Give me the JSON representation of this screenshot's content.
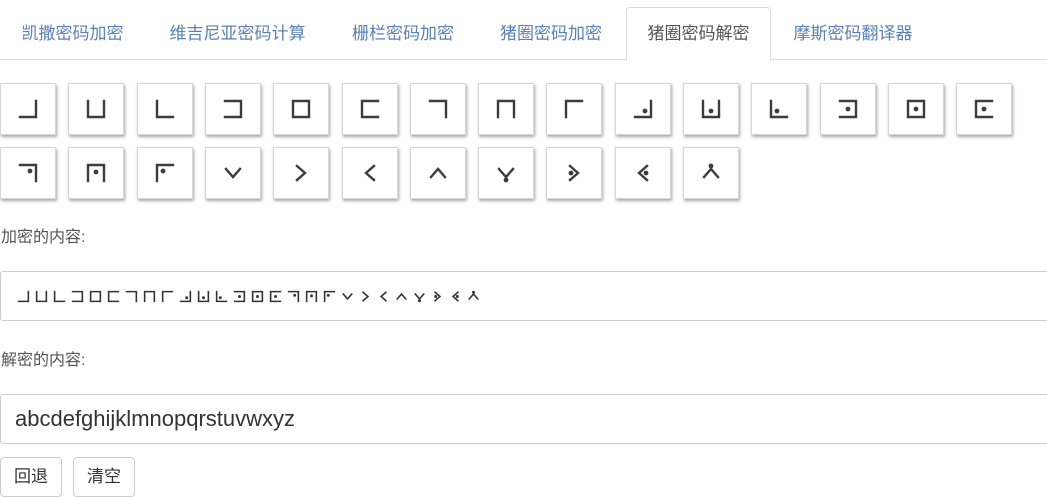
{
  "tabs": [
    {
      "label": "凯撒密码加密"
    },
    {
      "label": "维吉尼亚密码计算"
    },
    {
      "label": "栅栏密码加密"
    },
    {
      "label": "猪圈密码加密"
    },
    {
      "label": "猪圈密码解密",
      "active": true
    },
    {
      "label": "摩斯密码翻译器"
    }
  ],
  "keys_row1": [
    {
      "glyph": "grid-br"
    },
    {
      "glyph": "grid-b"
    },
    {
      "glyph": "grid-bl"
    },
    {
      "glyph": "grid-r"
    },
    {
      "glyph": "grid-c"
    },
    {
      "glyph": "grid-l"
    },
    {
      "glyph": "grid-tr"
    },
    {
      "glyph": "grid-t"
    },
    {
      "glyph": "grid-tl"
    },
    {
      "glyph": "grid-br-dot"
    },
    {
      "glyph": "grid-b-dot"
    },
    {
      "glyph": "grid-bl-dot"
    },
    {
      "glyph": "grid-r-dot"
    },
    {
      "glyph": "grid-c-dot"
    },
    {
      "glyph": "grid-l-dot"
    }
  ],
  "keys_row2": [
    {
      "glyph": "grid-tr-dot"
    },
    {
      "glyph": "grid-t-dot"
    },
    {
      "glyph": "grid-tl-dot"
    },
    {
      "glyph": "x-b"
    },
    {
      "glyph": "x-l"
    },
    {
      "glyph": "x-r"
    },
    {
      "glyph": "x-t"
    },
    {
      "glyph": "x-b-dot"
    },
    {
      "glyph": "x-l-dot"
    },
    {
      "glyph": "x-r-dot"
    },
    {
      "glyph": "x-t-dot"
    }
  ],
  "encrypted": {
    "label": "加密的内容:",
    "glyphs": [
      "grid-br",
      "grid-b",
      "grid-bl",
      "grid-r",
      "grid-c",
      "grid-l",
      "grid-tr",
      "grid-t",
      "grid-tl",
      "grid-br-dot",
      "grid-b-dot",
      "grid-bl-dot",
      "grid-r-dot",
      "grid-c-dot",
      "grid-l-dot",
      "grid-tr-dot",
      "grid-t-dot",
      "grid-tl-dot",
      "x-b",
      "x-l",
      "x-r",
      "x-t",
      "x-b-dot",
      "x-l-dot",
      "x-r-dot",
      "x-t-dot"
    ]
  },
  "decrypted": {
    "label": "解密的内容:",
    "value": "abcdefghijklmnopqrstuvwxyz"
  },
  "buttons": {
    "back_label": "回退",
    "clear_label": "清空"
  }
}
